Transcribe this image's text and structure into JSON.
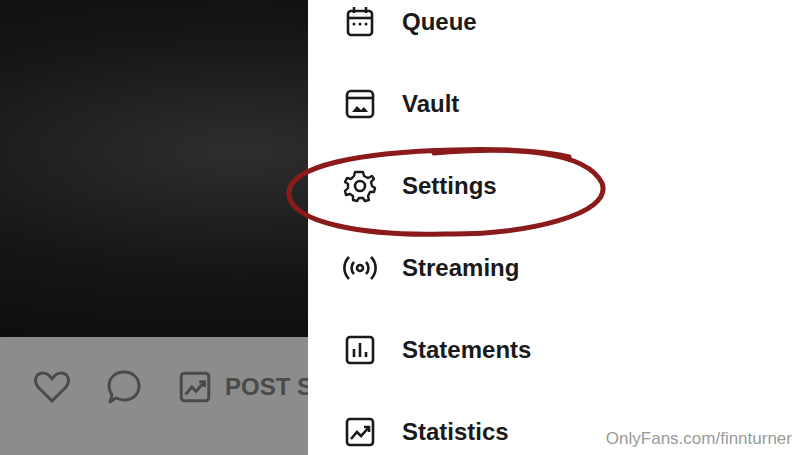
{
  "photo": {
    "kind": "dark-photo"
  },
  "post_bar": {
    "liked": false,
    "stats_label": "POST S"
  },
  "menu": {
    "items": [
      {
        "label": "Queue",
        "highlighted": false
      },
      {
        "label": "Vault",
        "highlighted": false
      },
      {
        "label": "Settings",
        "highlighted": true
      },
      {
        "label": "Streaming",
        "highlighted": false
      },
      {
        "label": "Statements",
        "highlighted": false
      },
      {
        "label": "Statistics",
        "highlighted": false
      }
    ]
  },
  "watermark": "OnlyFans.com/finnturner"
}
